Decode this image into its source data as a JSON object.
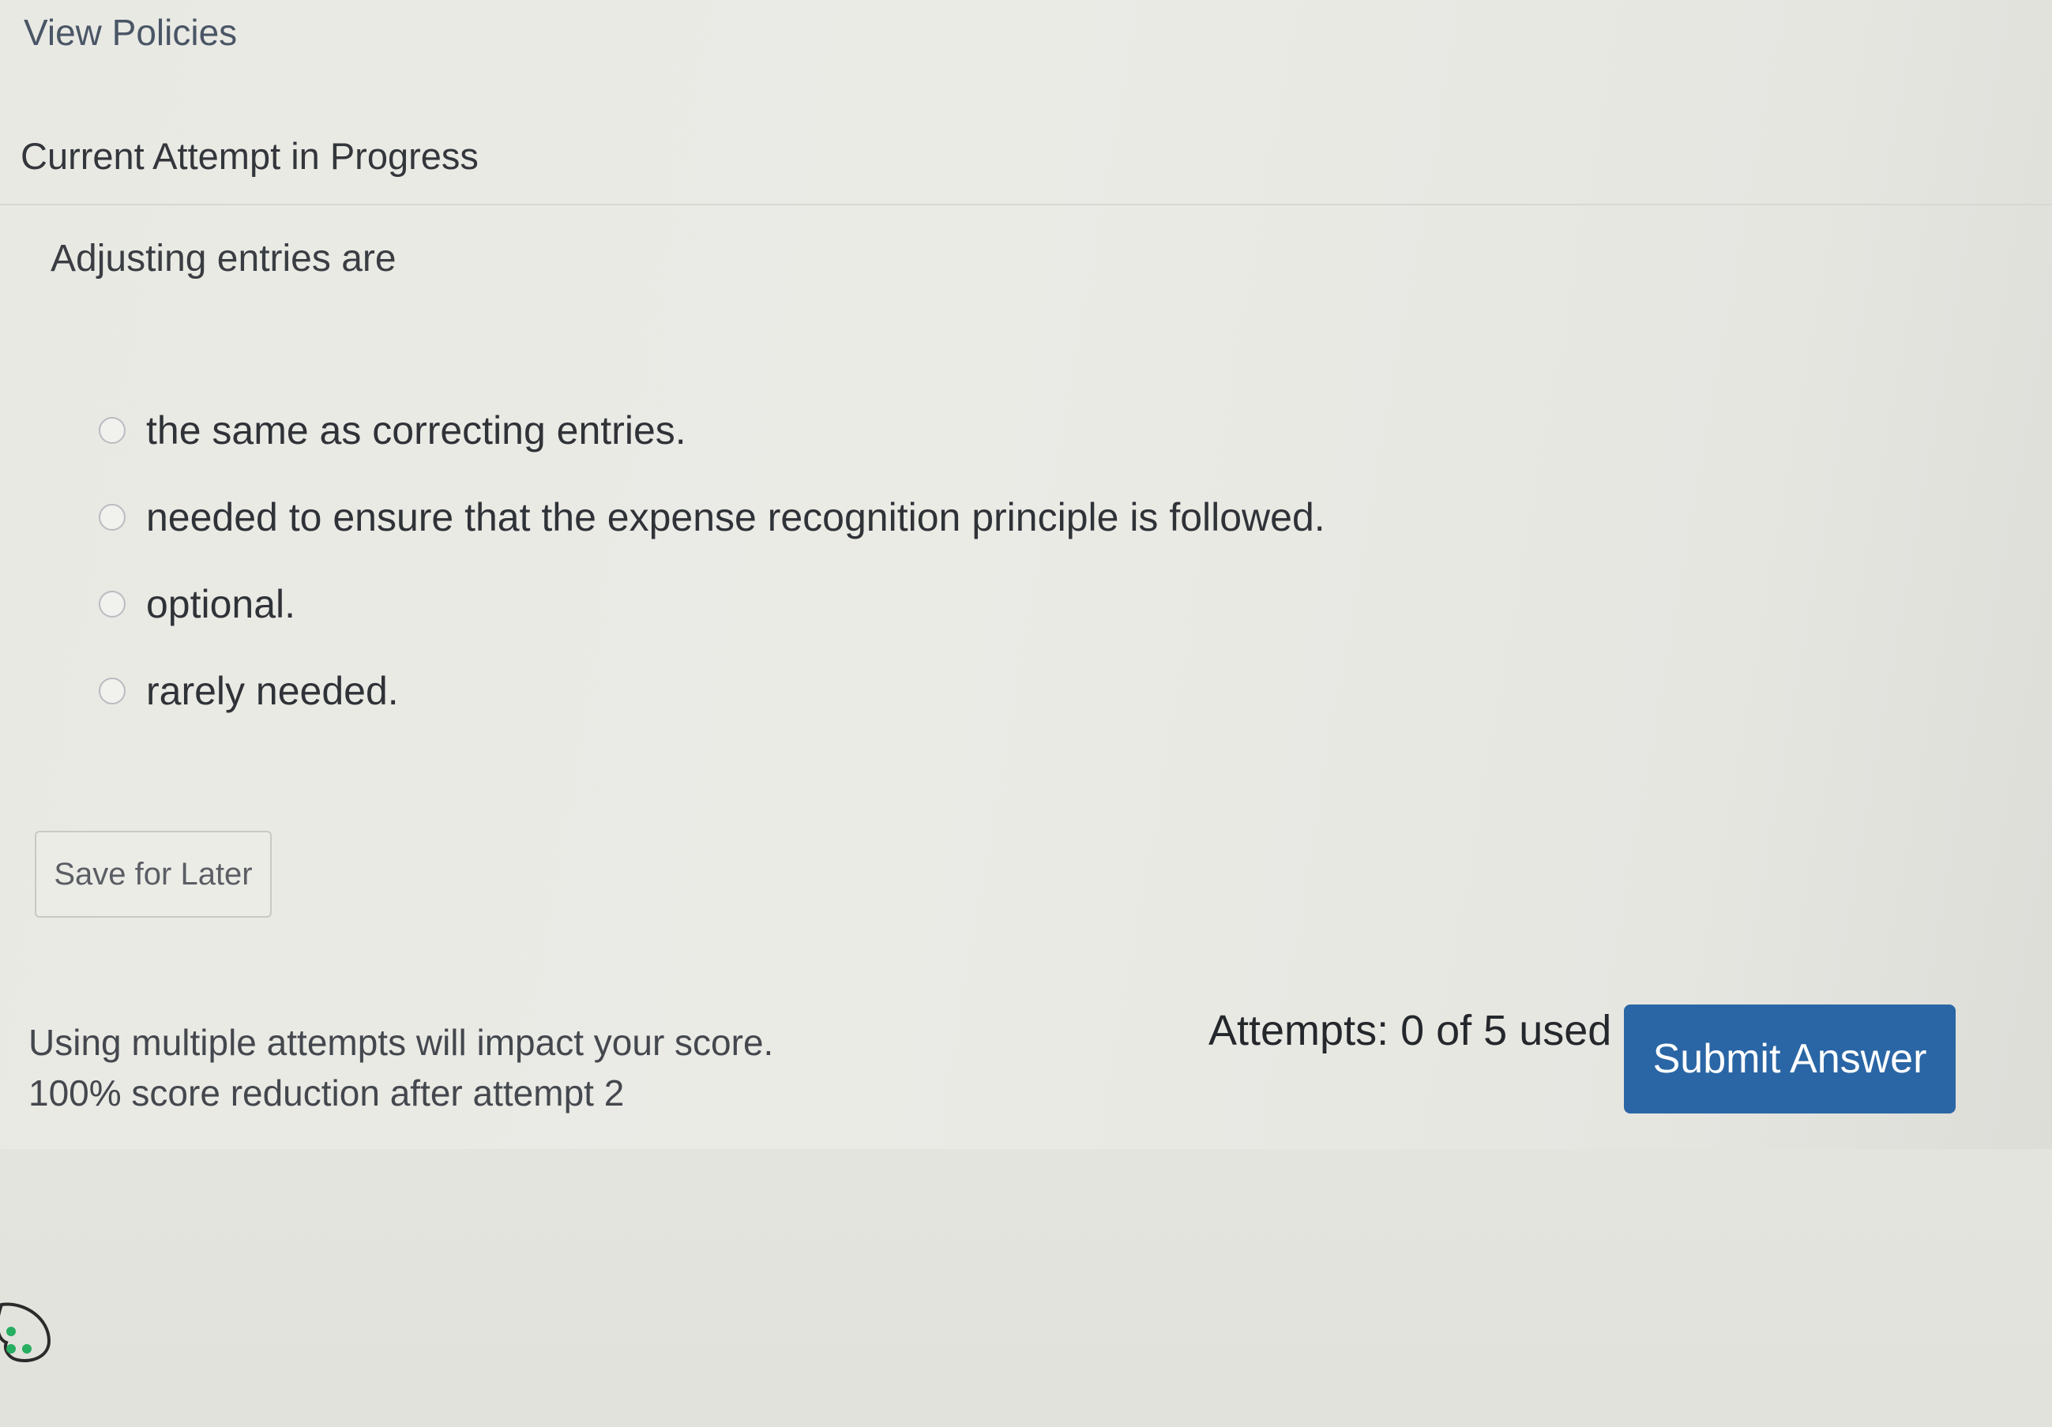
{
  "header": {
    "view_policies_link": "View Policies",
    "attempt_heading": "Current Attempt in Progress"
  },
  "question": {
    "prompt": "Adjusting entries are",
    "options": [
      {
        "label": "the same as correcting entries.",
        "selected": false
      },
      {
        "label": "needed to ensure that the expense recognition principle is followed.",
        "selected": false
      },
      {
        "label": "optional.",
        "selected": false
      },
      {
        "label": "rarely needed.",
        "selected": false
      }
    ]
  },
  "actions": {
    "save_label": "Save for Later",
    "submit_label": "Submit Answer"
  },
  "attempts": {
    "note_line1": "Using multiple attempts will impact your score.",
    "note_line2": "100% score reduction after attempt 2",
    "count_text": "Attempts: 0 of 5 used"
  },
  "colors": {
    "submit_button": "#2a66a5",
    "link": "#4a5666",
    "help_icon": "#27ae60"
  },
  "icons": {
    "help": "help-chat-icon"
  }
}
